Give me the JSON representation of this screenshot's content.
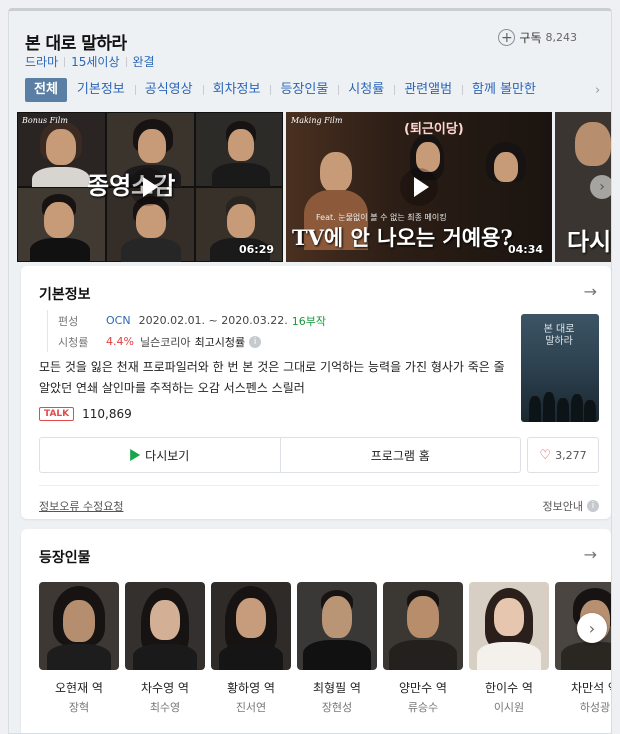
{
  "program": {
    "title": "본 대로 말하라",
    "meta": [
      "드라마",
      "15세이상",
      "완결"
    ],
    "subscribe_label": "구독",
    "subscribe_count": "8,243"
  },
  "tabs": [
    "전체",
    "기본정보",
    "공식영상",
    "회차정보",
    "등장인물",
    "시청률",
    "관련앨범",
    "함께 볼만한"
  ],
  "videos": [
    {
      "tag": "Bonus Film",
      "overlay": "종영소감",
      "duration": "06:29"
    },
    {
      "tag": "Making Film",
      "overlay_top": "(퇴근이당)",
      "overlay_small": "Feat. 눈물없이 볼 수 없는 최종 메이킹",
      "overlay": "TV에 안 나오는 거예용?",
      "duration": "04:34"
    },
    {
      "overlay": "다시"
    }
  ],
  "basic_info": {
    "heading": "기본정보",
    "broadcast_label": "편성",
    "channel": "OCN",
    "period": "2020.02.01. ~ 2020.03.22.",
    "episodes": "16부작",
    "rating_label": "시청률",
    "rating": "4.4%",
    "rating_source": "닐슨코리아",
    "rating_peak": "최고시청률",
    "description": "모든 것을 잃은 천재 프로파일러와 한 번 본 것은 그대로 기억하는 능력을 가진 형사가 죽은 줄 알았던 연쇄 살인마를 추적하는 오감 서스펜스 스릴러",
    "talk_badge": "TALK",
    "talk_count": "110,869",
    "poster_title": "본 대로 말하라",
    "rewatch_label": "다시보기",
    "home_label": "프로그램 홈",
    "like_count": "3,277",
    "error_report": "정보오류 수정요청",
    "guide": "정보안내"
  },
  "cast_section": {
    "heading": "등장인물",
    "people": [
      {
        "role": "오현재 역",
        "actor": "장혁"
      },
      {
        "role": "차수영 역",
        "actor": "최수영"
      },
      {
        "role": "황하영 역",
        "actor": "진서연"
      },
      {
        "role": "최형필 역",
        "actor": "장현성"
      },
      {
        "role": "양만수 역",
        "actor": "류승수"
      },
      {
        "role": "한이수 역",
        "actor": "이시원"
      },
      {
        "role": "차만석 역",
        "actor": "하성광"
      }
    ]
  },
  "icons": {
    "subscribe": "plus-circle-icon",
    "arrow": "arrow-right-icon",
    "play": "play-icon",
    "heart": "heart-icon",
    "next": "chevron-right-icon",
    "info": "question-icon"
  },
  "colors": {
    "accent": "#5b7fa4",
    "link": "#2c66b8",
    "green": "#159a3a",
    "red": "#e23d3d"
  }
}
